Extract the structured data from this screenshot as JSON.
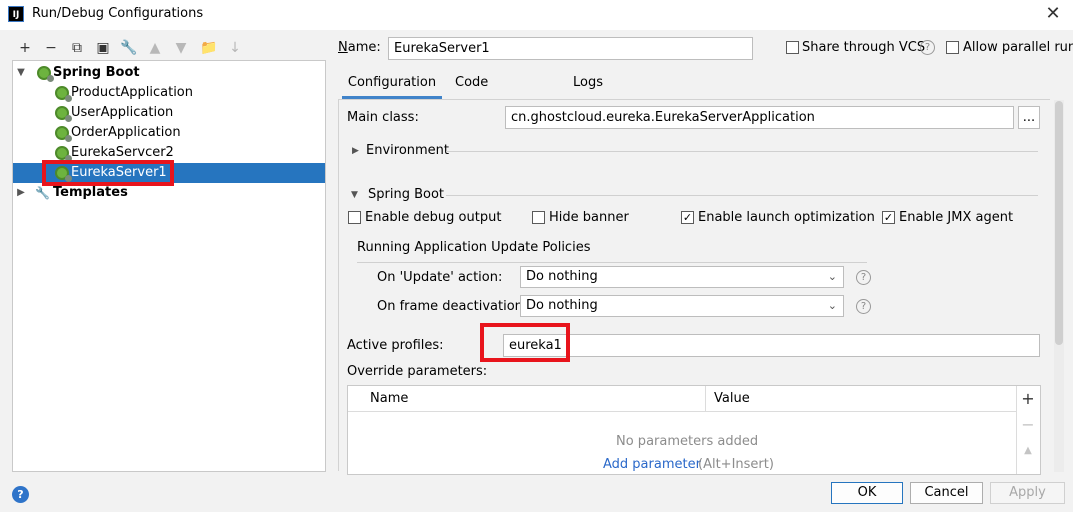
{
  "window": {
    "title": "Run/Debug Configurations",
    "app_icon_text": "IJ",
    "close_glyph": "✕"
  },
  "toolbar": [
    {
      "name": "add-icon",
      "glyph": "+",
      "dim": false
    },
    {
      "name": "remove-icon",
      "glyph": "−",
      "dim": false
    },
    {
      "name": "copy-icon",
      "glyph": "⧉",
      "dim": false
    },
    {
      "name": "save-icon",
      "glyph": "▣",
      "dim": false
    },
    {
      "name": "wrench-icon",
      "glyph": "🔧",
      "dim": false
    },
    {
      "name": "move-up-icon",
      "glyph": "▲",
      "dim": true
    },
    {
      "name": "move-down-icon",
      "glyph": "▼",
      "dim": true
    },
    {
      "name": "folder-icon",
      "glyph": "📁",
      "dim": false
    },
    {
      "name": "sort-icon",
      "glyph": "↓",
      "dim": true
    }
  ],
  "tree": {
    "spring_boot": "Spring Boot",
    "items": [
      "ProductApplication",
      "UserApplication",
      "OrderApplication",
      "EurekaServcer2",
      "EurekaServer1"
    ],
    "templates": "Templates"
  },
  "header": {
    "name_label": "Name:",
    "name_value": "EurekaServer1",
    "share_label": "Share through VCS",
    "parallel_label": "Allow parallel run"
  },
  "tabs": [
    "Configuration",
    "Code Coverage",
    "Logs"
  ],
  "config": {
    "main_class_label": "Main class:",
    "main_class_value": "cn.ghostcloud.eureka.EurekaServerApplication",
    "browse_label": "...",
    "environment_label": "Environment",
    "spring_boot_label": "Spring Boot",
    "enable_debug_label": "Enable debug output",
    "hide_banner_label": "Hide banner",
    "launch_opt_label": "Enable launch optimization",
    "jmx_label": "Enable JMX agent",
    "checks": {
      "debug": "",
      "banner": "",
      "launch": "✓",
      "jmx": "✓"
    },
    "policies_label": "Running Application Update Policies",
    "update_action_label": "On 'Update' action:",
    "update_action_value": "Do nothing",
    "frame_deact_label": "On frame deactivation:",
    "frame_deact_value": "Do nothing",
    "help_glyph": "?",
    "active_profiles_label": "Active profiles:",
    "active_profiles_value": "eureka1",
    "override_label": "Override parameters:",
    "table_col_name": "Name",
    "table_col_value": "Value",
    "empty_text": "No parameters added",
    "add_param_link": "Add parameter",
    "add_param_hint": "(Alt+Insert)",
    "side_add": "+",
    "side_remove": "−",
    "side_up": "▲"
  },
  "buttons": {
    "ok": "OK",
    "cancel": "Cancel",
    "apply": "Apply",
    "help": "?"
  },
  "colors": {
    "selection": "#2675bf",
    "highlight_box": "#e8141c",
    "link": "#2a68c9"
  }
}
